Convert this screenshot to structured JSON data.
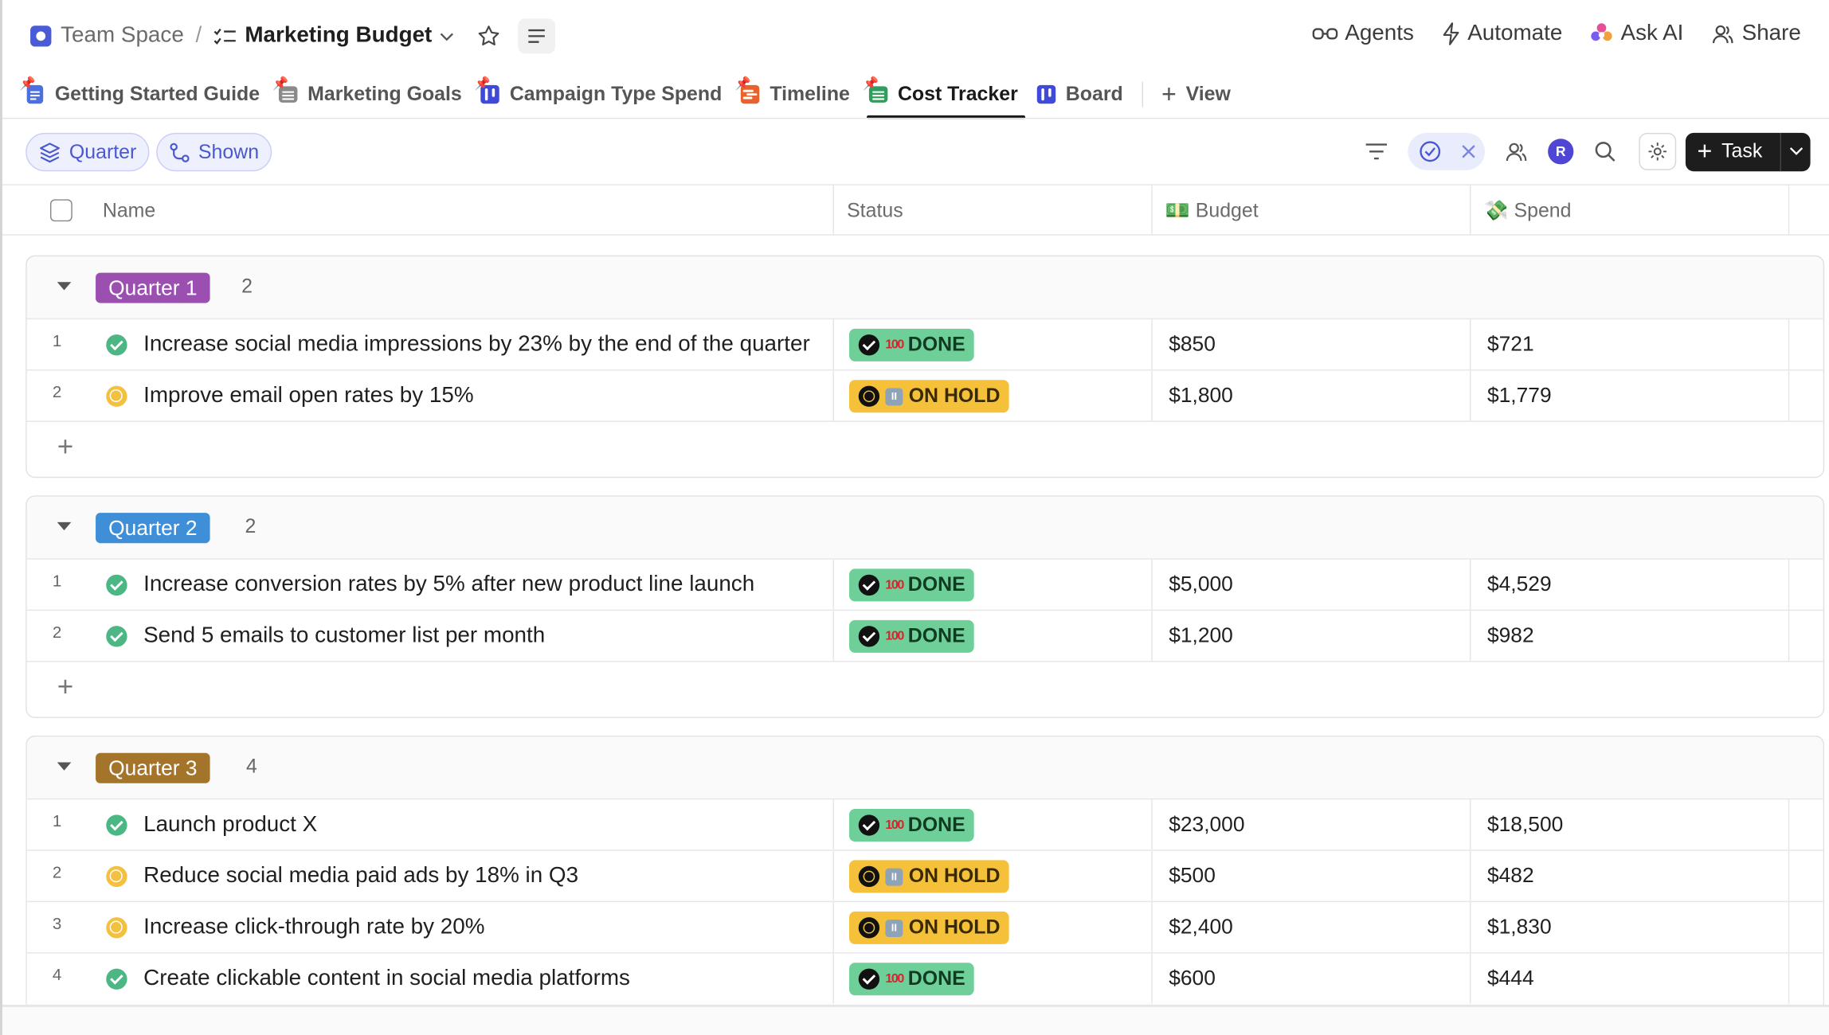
{
  "breadcrumb": {
    "space": "Team Space",
    "separator": "/",
    "list": "Marketing Budget"
  },
  "top_actions": [
    {
      "label": "Agents",
      "icon": "agents-icon"
    },
    {
      "label": "Automate",
      "icon": "lightning-icon"
    },
    {
      "label": "Ask AI",
      "icon": "ai-sparkle-icon"
    },
    {
      "label": "Share",
      "icon": "share-icon"
    }
  ],
  "views": [
    {
      "label": "Getting Started Guide",
      "icon": "doc-icon",
      "color": "#4a6fe0"
    },
    {
      "label": "Marketing Goals",
      "icon": "table-icon",
      "color": "#8a8a8a"
    },
    {
      "label": "Campaign Type Spend",
      "icon": "board-icon",
      "color": "#3f4ad8"
    },
    {
      "label": "Timeline",
      "icon": "timeline-icon",
      "color": "#e8622e"
    },
    {
      "label": "Cost Tracker",
      "icon": "table-icon",
      "color": "#2f9e5e",
      "active": true
    },
    {
      "label": "Board",
      "icon": "board-icon",
      "color": "#3f4ad8"
    }
  ],
  "add_view_label": "View",
  "filters": {
    "group_by": "Quarter",
    "subtasks": "Shown"
  },
  "toolbar": {
    "avatar_initial": "R",
    "task_label": "Task"
  },
  "columns": {
    "name": "Name",
    "status": "Status",
    "budget": "💵 Budget",
    "spend": "💸 Spend"
  },
  "groups": [
    {
      "label": "Quarter 1",
      "color": "#9b4fb0",
      "count": "2",
      "rows": [
        {
          "num": "1",
          "name": "Increase social media impressions by 23% by the end of the quarter",
          "status": "DONE",
          "status_type": "done",
          "budget": "$850",
          "spend": "$721"
        },
        {
          "num": "2",
          "name": "Improve email open rates by 15%",
          "status": "ON HOLD",
          "status_type": "hold",
          "budget": "$1,800",
          "spend": "$1,779"
        }
      ]
    },
    {
      "label": "Quarter 2",
      "color": "#3f8fd8",
      "count": "2",
      "rows": [
        {
          "num": "1",
          "name": "Increase conversion rates by 5% after new product line launch",
          "status": "DONE",
          "status_type": "done",
          "budget": "$5,000",
          "spend": "$4,529"
        },
        {
          "num": "2",
          "name": "Send 5 emails to customer list per month",
          "status": "DONE",
          "status_type": "done",
          "budget": "$1,200",
          "spend": "$982"
        }
      ]
    },
    {
      "label": "Quarter 3",
      "color": "#a5742b",
      "count": "4",
      "rows": [
        {
          "num": "1",
          "name": "Launch product X",
          "status": "DONE",
          "status_type": "done",
          "budget": "$23,000",
          "spend": "$18,500"
        },
        {
          "num": "2",
          "name": "Reduce social media paid ads by 18% in Q3",
          "status": "ON HOLD",
          "status_type": "hold",
          "budget": "$500",
          "spend": "$482"
        },
        {
          "num": "3",
          "name": "Increase click-through rate by 20%",
          "status": "ON HOLD",
          "status_type": "hold",
          "budget": "$2,400",
          "spend": "$1,830"
        },
        {
          "num": "4",
          "name": "Create clickable content in social media platforms",
          "status": "DONE",
          "status_type": "done",
          "budget": "$600",
          "spend": "$444"
        }
      ]
    }
  ]
}
